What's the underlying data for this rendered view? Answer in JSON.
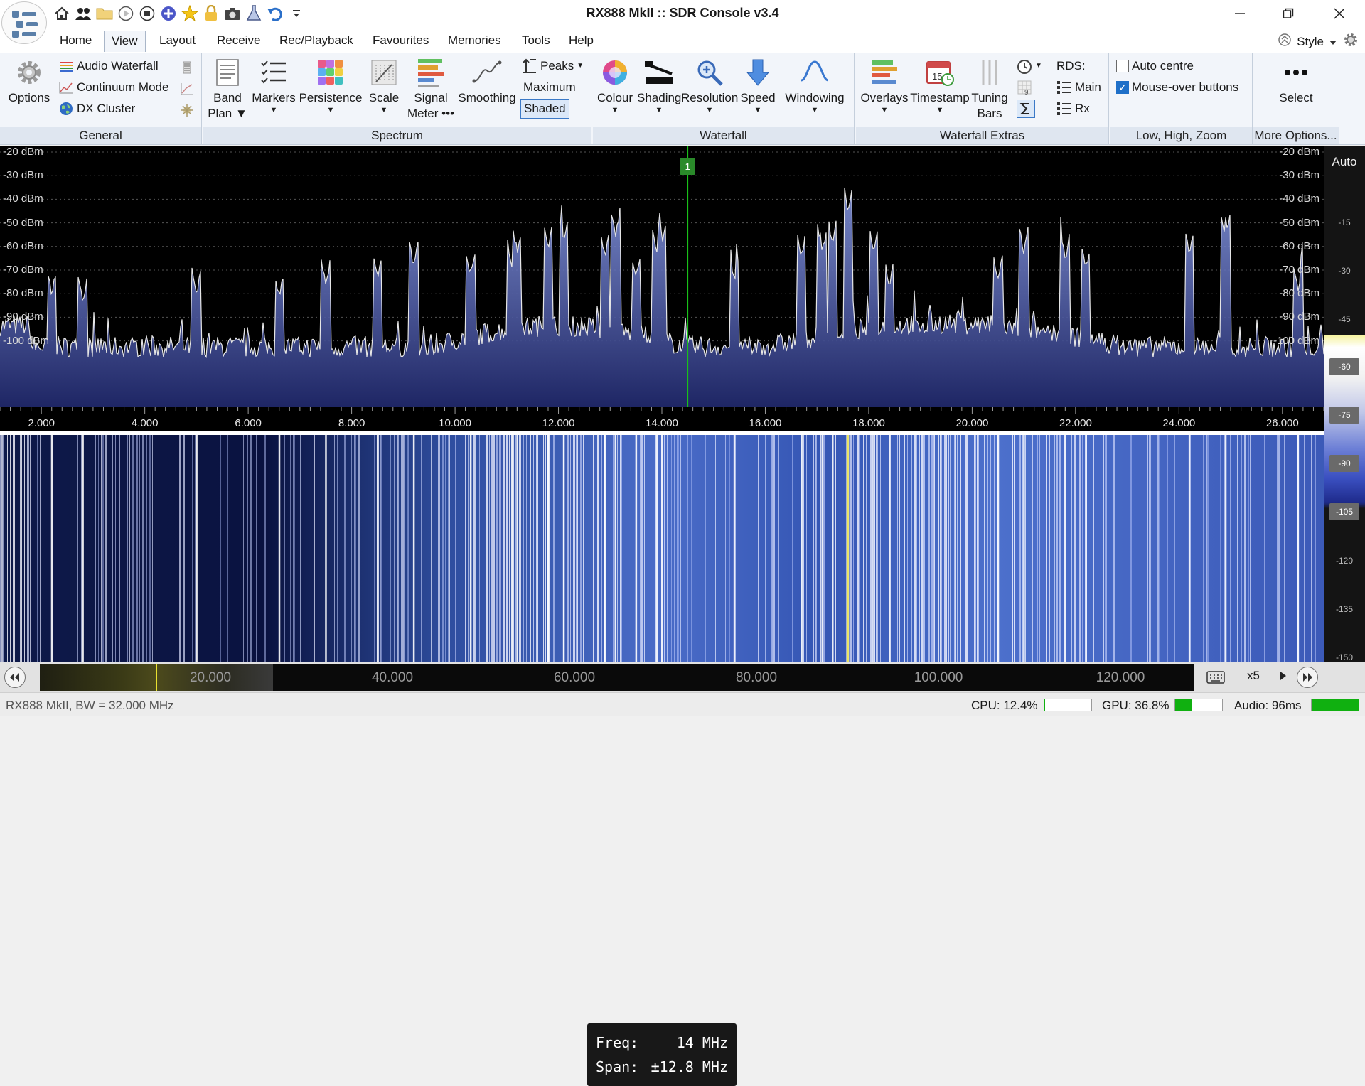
{
  "window": {
    "title": "RX888 MkII :: SDR Console v3.4",
    "quick_access_icons": [
      "home-icon",
      "users-icon",
      "folder-icon",
      "play-icon",
      "stop-icon",
      "plus-circle-icon",
      "star-icon",
      "lock-icon",
      "camera-icon",
      "flask-icon",
      "undo-icon",
      "customize-icon"
    ]
  },
  "menu": {
    "tabs": [
      "Home",
      "View",
      "Layout",
      "Receive",
      "Rec/Playback",
      "Favourites",
      "Memories",
      "Tools",
      "Help"
    ],
    "active_tab": "View",
    "style_label": "Style"
  },
  "ribbon": {
    "groups": {
      "general": "General",
      "spectrum": "Spectrum",
      "waterfall": "Waterfall",
      "waterfall_extras": "Waterfall Extras",
      "low_high_zoom": "Low, High, Zoom",
      "more_options": "More Options..."
    },
    "general": {
      "options": "Options",
      "audio_waterfall": "Audio Waterfall",
      "continuum_mode": "Continuum Mode",
      "dx_cluster": "DX Cluster"
    },
    "spectrum": {
      "band_plan_1": "Band",
      "band_plan_2": "Plan",
      "markers": "Markers",
      "persistence": "Persistence",
      "scale": "Scale",
      "signal_meter_1": "Signal",
      "signal_meter_2": "Meter",
      "signal_meter_more": "•••",
      "smoothing": "Smoothing",
      "peaks": "Peaks",
      "maximum": "Maximum",
      "shaded": "Shaded"
    },
    "waterfall": {
      "colour": "Colour",
      "shading": "Shading",
      "resolution": "Resolution",
      "speed": "Speed",
      "windowing": "Windowing"
    },
    "waterfall_extras": {
      "overlays": "Overlays",
      "timestamp": "Timestamp",
      "tuning_bars_1": "Tuning",
      "tuning_bars_2": "Bars",
      "timestamp_badge": "15",
      "grid_badge": "9",
      "rds": "RDS:",
      "main": "Main",
      "rx": "Rx"
    },
    "low_high_zoom": {
      "auto_centre": "Auto centre",
      "auto_centre_checked": false,
      "mouse_over_buttons": "Mouse-over buttons",
      "mouse_over_buttons_checked": true
    },
    "more_options": {
      "select": "Select"
    }
  },
  "spectrum": {
    "db_labels": [
      "-20 dBm",
      "-30 dBm",
      "-40 dBm",
      "-50 dBm",
      "-60 dBm",
      "-70 dBm",
      "-80 dBm",
      "-90 dBm",
      "-100 dBm"
    ],
    "db_values": [
      -20,
      -30,
      -40,
      -50,
      -60,
      -70,
      -80,
      -90,
      -100
    ],
    "freq_labels": [
      "2.000",
      "4.000",
      "6.000",
      "8.000",
      "10.000",
      "12.000",
      "14.000",
      "16.000",
      "18.000",
      "20.000",
      "22.000",
      "24.000",
      "26.000"
    ],
    "freq_min_mhz": 1.2,
    "freq_max_mhz": 26.8,
    "marker_label": "1",
    "marker_freq_mhz": 14.5
  },
  "tooltip": {
    "freq_label": "Freq:",
    "freq_value": "14 MHz",
    "span_label": "Span:",
    "span_value": "±12.8 MHz"
  },
  "right_scale": {
    "auto_label": "Auto",
    "labels": [
      "-15",
      "-30",
      "-45",
      "-60",
      "-75",
      "-90",
      "-105",
      "-120",
      "-135",
      "-150"
    ],
    "boxed": [
      "-60",
      "-75",
      "-90",
      "-105"
    ]
  },
  "navigator": {
    "labels": [
      "20.000",
      "40.000",
      "60.000",
      "80.000",
      "100.000",
      "120.000"
    ],
    "zoom": "x5"
  },
  "status": {
    "device": "RX888 MkII, BW = 32.000 MHz",
    "cpu": "CPU: 12.4%",
    "cpu_fraction": 0.02,
    "gpu": "GPU: 36.8%",
    "gpu_fraction": 0.37,
    "audio": "Audio: 96ms",
    "audio_fraction": 1.0,
    "meter_color": "#10b010"
  }
}
